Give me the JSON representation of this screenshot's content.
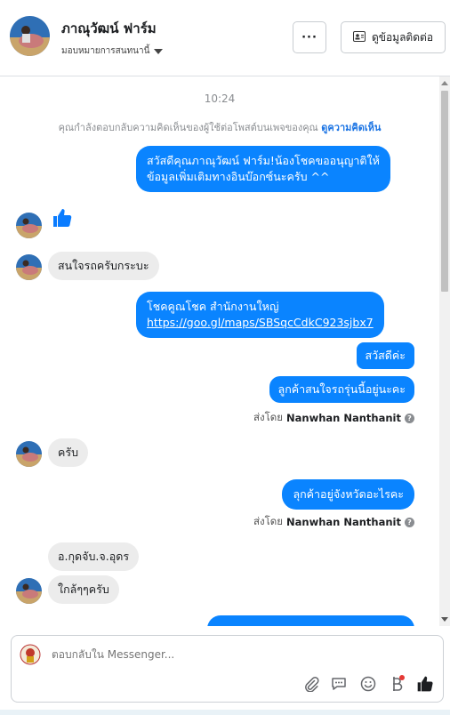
{
  "header": {
    "page_name": "ภาณุวัฒน์ ฟาร์ม",
    "assign_label": "มอบหมายการสนทนานี้",
    "more_label": "···",
    "contact_label": "ดูข้อมูลติดต่อ"
  },
  "chat": {
    "timestamp": "10:24",
    "notice_text": "คุณกำลังตอบกลับความคิดเห็นของผู้ใช้ต่อโพสต์บนเพจของคุณ",
    "notice_link": "ดูความคิดเห็น",
    "messages": {
      "m1_line1": "สวัสดีคุณภาณุวัฒน์ ฟาร์ม!น้องโชคขออนุญาติให้",
      "m1_line2": "ข้อมูลเพิ่มเติมทางอินบ๊อกซ์นะครับ ^^",
      "m2": "สนใจรถครับกระบะ",
      "m3_line1": "โชคคูณโชค สำนักงานใหญ่",
      "m3_link": "https://goo.gl/maps/SBSqcCdkC923sjbx7",
      "m4": "สวัสดีค่ะ",
      "m5": "ลูกค้าสนใจรถรุ่นนี้อยู่นะคะ",
      "m6": "ครับ",
      "m7": "ลุกค้าอยู่จังหวัดอะไรคะ",
      "m8": "อ.กุดจับ.จ.อุดร",
      "m9": "ใกล้ๆๆครับ"
    },
    "sent_by_prefix": "ส่งโดย",
    "sent_by_name": "Nanwhan Nanthanit",
    "info_mark": "?"
  },
  "composer": {
    "placeholder": "ตอบกลับใน Messenger..."
  },
  "colors": {
    "outgoing_bubble": "#0a84ff",
    "incoming_bubble": "#ececec",
    "link": "#1b74e4",
    "like": "#0a7cff"
  },
  "icons": [
    "more-icon",
    "contact-card-icon",
    "caret-down-icon",
    "thumbs-up-icon",
    "attach-icon",
    "saved-reply-icon",
    "emoji-icon",
    "baht-icon",
    "like-icon",
    "info-icon"
  ]
}
